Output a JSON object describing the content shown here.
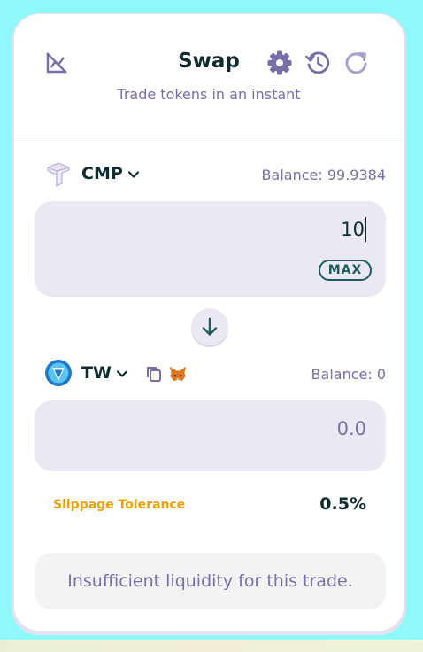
{
  "header": {
    "title": "Swap",
    "subtitle": "Trade tokens in an instant",
    "icons": [
      "chart-disabled-icon",
      "gear-icon",
      "history-icon",
      "refresh-icon"
    ]
  },
  "from": {
    "token": "CMP",
    "balance": "Balance: 99.9384",
    "amount": "10",
    "max_label": "MAX"
  },
  "to": {
    "token": "TW",
    "balance": "Balance: 0",
    "placeholder": "0.0"
  },
  "slippage": {
    "label": "Slippage Tolerance",
    "value": "0.5%"
  },
  "notice": "Insufficient liquidity for this trade.",
  "colors": {
    "background": "#8ff9f9",
    "card": "#ffffff",
    "accent_purple": "#7a6ea9",
    "dark_text": "#0e2b2f",
    "input_bg": "#eae8f2",
    "slippage_label": "#f0a000"
  }
}
